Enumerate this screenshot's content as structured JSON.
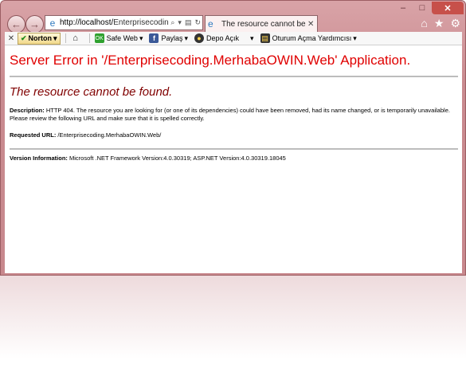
{
  "browser": {
    "address_url": "http://localhost/Enterprisecoding.Me",
    "address_url_host": "http://localhost/",
    "address_url_path": "Enterprisecoding.Me",
    "tab_title": "The resource cannot be fou...",
    "window_controls": [
      "–",
      "□",
      "✕"
    ],
    "right_icons": [
      "home-icon",
      "star-icon",
      "gear-icon"
    ]
  },
  "toolbar": {
    "close_label": "✕",
    "norton_label": "Norton",
    "safe_web_label": "Safe Web",
    "share_label": "Paylaş",
    "vault_label": "Depo Açık",
    "login_assistant_label": "Oturum Açma Yardımcısı"
  },
  "page": {
    "title": "Server Error in '/Enterprisecoding.MerhabaOWIN.Web' Application.",
    "subtitle": "The resource cannot be found.",
    "description_label": "Description:",
    "description_text": " HTTP 404. The resource you are looking for (or one of its dependencies) could have been removed, had its name changed, or is temporarily unavailable.  Please review the following URL and make sure that it is spelled correctly.",
    "requested_url_label": "Requested URL:",
    "requested_url_value": " /Enterprisecoding.MerhabaOWIN.Web/",
    "version_label": "Version Information:",
    "version_value": " Microsoft .NET Framework Version:4.0.30319; ASP.NET Version:4.0.30319.18045"
  }
}
